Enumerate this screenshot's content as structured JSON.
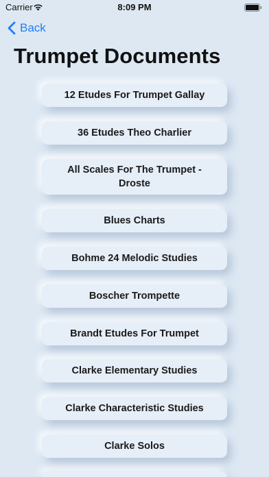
{
  "status_bar": {
    "carrier": "Carrier",
    "time": "8:09 PM"
  },
  "nav": {
    "back_label": "Back"
  },
  "page_title": "Trumpet Documents",
  "documents": [
    "12 Etudes For Trumpet Gallay",
    "36 Etudes Theo Charlier",
    "All Scales For The Trumpet - Droste",
    "Blues Charts",
    "Bohme 24 Melodic Studies",
    "Boscher Trompette",
    "Brandt Etudes For Trumpet",
    "Clarke Elementary Studies",
    "Clarke Characteristic Studies",
    "Clarke Solos",
    ""
  ],
  "colors": {
    "accent": "#1f7ff5",
    "background": "#dde8f3",
    "card": "#e6eef8"
  }
}
